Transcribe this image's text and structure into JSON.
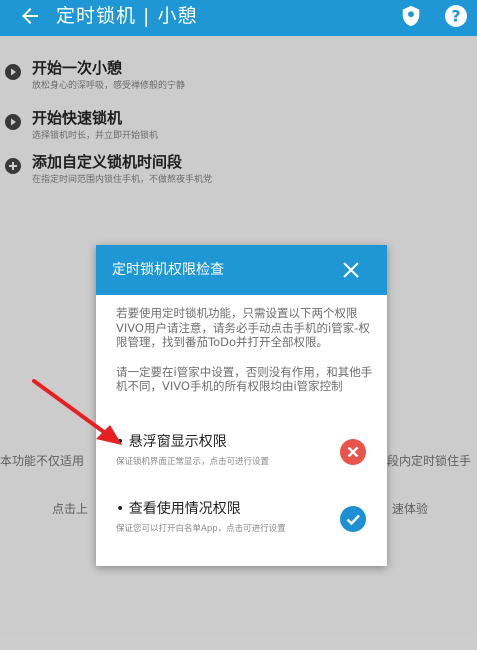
{
  "app_bar": {
    "title": "定时锁机 | 小憩",
    "color": "#1f97d5"
  },
  "list": [
    {
      "title": "开始一次小憩",
      "subtitle": "放松身心的深呼吸，感受禅修般的宁静",
      "icon": "play-icon"
    },
    {
      "title": "开始快速锁机",
      "subtitle": "选择锁机时长，并立即开始锁机",
      "icon": "play-icon"
    },
    {
      "title": "添加自定义锁机时间段",
      "subtitle": "在指定时间范围内锁住手机，不做熬夜手机党",
      "icon": "add-icon"
    }
  ],
  "background_text": {
    "line1_left": "本功能不仅适用",
    "line1_right": "段内定时锁住手",
    "line2_left": "点击上",
    "line2_right": "速体验"
  },
  "dialog": {
    "title": "定时锁机权限检查",
    "paragraph1": "若要使用定时锁机功能，只需设置以下两个权限",
    "paragraph2": "VIVO用户请注意，请务必手动点击手机的i管家-权限管理，找到番茄ToDo并打开全部权限。",
    "paragraph3": "请一定要在i管家中设置，否则没有作用，和其他手机不同，VIVO手机的所有权限均由i管家控制",
    "permissions": [
      {
        "name": "• 悬浮窗显示权限",
        "description": "保证锁机界面正常显示，点击可进行设置",
        "granted": false,
        "status_color": "#e8534a"
      },
      {
        "name": "• 查看使用情况权限",
        "description": "保证您可以打开白名单App，点击可进行设置",
        "granted": true,
        "status_color": "#1e8fd2"
      }
    ]
  }
}
